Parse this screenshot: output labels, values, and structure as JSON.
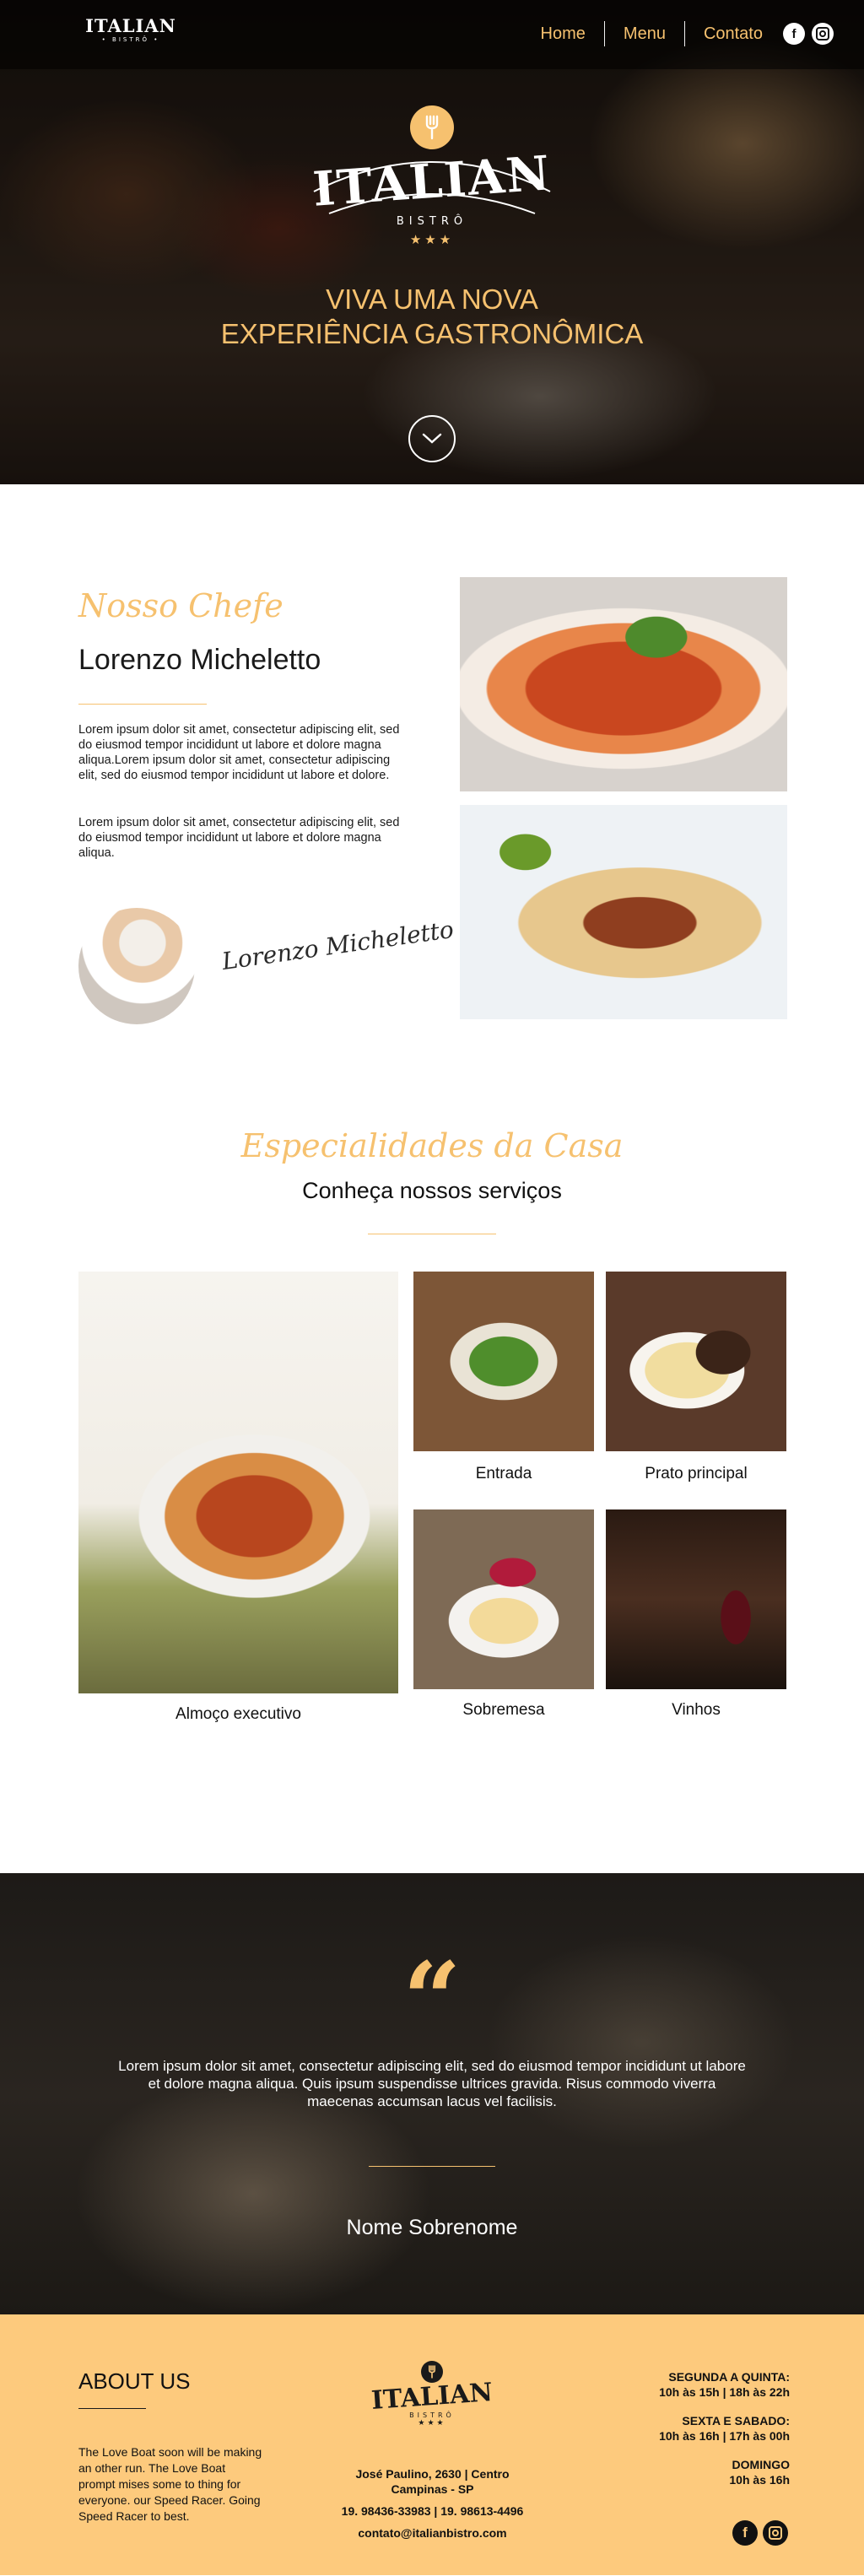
{
  "header": {
    "brand_title": "ITALIAN",
    "brand_sub": "• BISTRÔ •",
    "nav": [
      "Home",
      "Menu",
      "Contato"
    ],
    "social": [
      {
        "name": "facebook-icon",
        "glyph": "f"
      },
      {
        "name": "instagram-icon",
        "glyph": ""
      }
    ]
  },
  "hero": {
    "logo_title": "ITALIAN",
    "logo_sub": "BISTRÔ",
    "logo_stars": "★★★",
    "tagline_line1": "VIVA UMA NOVA",
    "tagline_line2": "EXPERIÊNCIA GASTRONÔMICA"
  },
  "chef": {
    "kicker": "Nosso Chefe",
    "name": "Lorenzo Micheletto",
    "paragraph1": "Lorem ipsum dolor sit amet, consectetur adipiscing elit, sed do eiusmod tempor incididunt ut labore et dolore magna aliqua.Lorem ipsum dolor sit amet, consectetur adipiscing elit, sed do eiusmod tempor incididunt ut labore et dolore.",
    "paragraph2": "Lorem ipsum dolor sit amet, consectetur adipiscing elit, sed do eiusmod tempor incididunt ut labore et dolore magna aliqua.",
    "signature": "Lorenzo Micheletto"
  },
  "specialties": {
    "kicker": "Especialidades da Casa",
    "title": "Conheça nossos serviços",
    "items": [
      {
        "label": "Almoço executivo"
      },
      {
        "label": "Entrada"
      },
      {
        "label": "Prato principal"
      },
      {
        "label": "Sobremesa"
      },
      {
        "label": "Vinhos"
      }
    ]
  },
  "testimonial": {
    "quote_mark": "“",
    "text": "Lorem ipsum dolor sit amet, consectetur adipiscing elit, sed do eiusmod tempor incididunt ut labore et dolore magna aliqua. Quis ipsum suspendisse ultrices gravida. Risus commodo viverra maecenas accumsan lacus vel facilisis.",
    "author": "Nome Sobrenome"
  },
  "footer": {
    "about_title": "ABOUT US",
    "about_text": "The Love Boat soon will be making an other run. The Love Boat prompt mises some to thing for everyone. our Speed Racer. Going Speed Racer to best.",
    "logo_title": "ITALIAN",
    "logo_sub": "BISTRÔ",
    "logo_stars": "★★★",
    "address_line1": "José Paulino, 2630 | Centro",
    "address_line2": "Campinas - SP",
    "phones": "19. 98436-33983 | 19. 98613-4496",
    "email": "contato@italianbistro.com",
    "hours": [
      {
        "days": "SEGUNDA A QUINTA:",
        "times": "10h às 15h | 18h às 22h"
      },
      {
        "days": "SEXTA E SABADO:",
        "times": "10h às 16h | 17h às 00h"
      },
      {
        "days": "DOMINGO",
        "times": "10h às 16h"
      }
    ]
  },
  "colors": {
    "accent_gold": "#f6c16f",
    "footer_bg": "#fdca7d",
    "text_dark": "#1a1a1a"
  }
}
